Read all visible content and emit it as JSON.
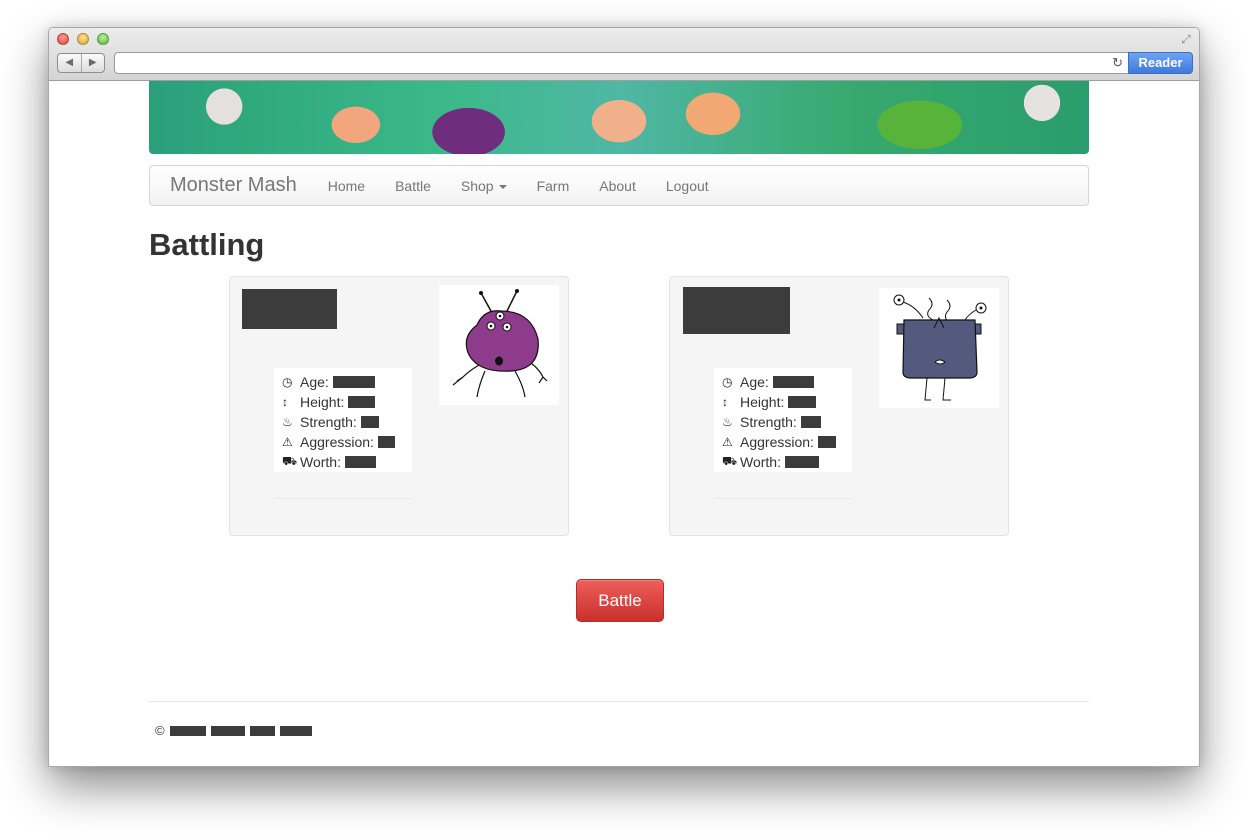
{
  "browser": {
    "reader_label": "Reader",
    "back_glyph": "◀",
    "forward_glyph": "▶",
    "reload_glyph": "↻",
    "fullscreen_glyph": "⤢"
  },
  "navbar": {
    "brand": "Monster Mash",
    "items": [
      {
        "label": "Home"
      },
      {
        "label": "Battle"
      },
      {
        "label": "Shop"
      },
      {
        "label": "Farm"
      },
      {
        "label": "About"
      },
      {
        "label": "Logout"
      }
    ]
  },
  "page": {
    "title": "Battling"
  },
  "monsters": [
    {
      "stats": {
        "age_label": "Age:",
        "height_label": "Height:",
        "strength_label": "Strength:",
        "aggression_label": "Aggression:",
        "worth_label": "Worth:"
      },
      "body_color": "#8e3b8c"
    },
    {
      "stats": {
        "age_label": "Age:",
        "height_label": "Height:",
        "strength_label": "Strength:",
        "aggression_label": "Aggression:",
        "worth_label": "Worth:"
      },
      "body_color": "#545a7e"
    }
  ],
  "actions": {
    "battle_label": "Battle"
  },
  "footer": {
    "copyright_symbol": "©"
  },
  "colors": {
    "danger": "#da4f49",
    "redaction": "#3c3c3c",
    "reader_blue": "#3f79dc"
  }
}
